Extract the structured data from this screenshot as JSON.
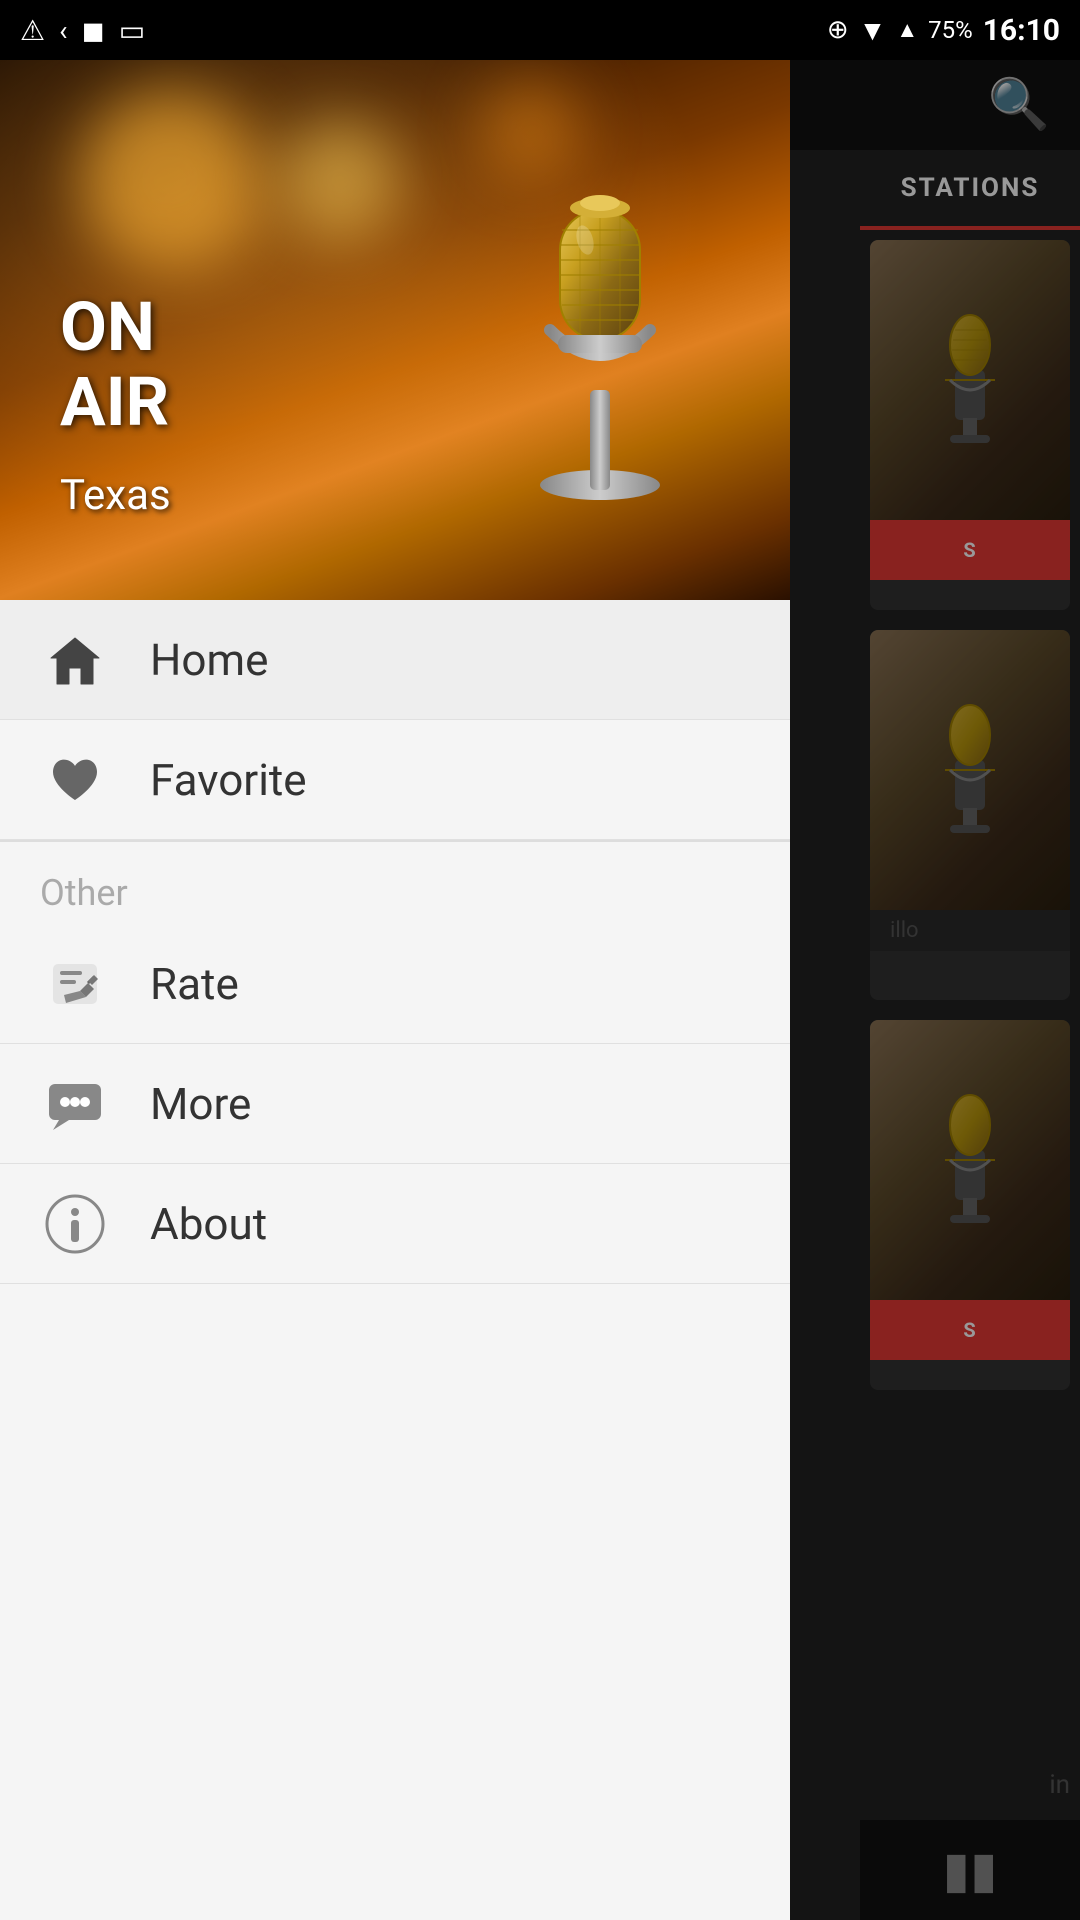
{
  "statusBar": {
    "time": "16:10",
    "battery": "75%"
  },
  "background": {
    "searchIconLabel": "search-icon",
    "stationsTab": "STATIONS",
    "playerPauseLabel": "pause"
  },
  "drawer": {
    "heroImage": {
      "onAirLine1": "ON",
      "onAirLine2": "AIR",
      "cityName": "Texas"
    },
    "menuItems": [
      {
        "id": "home",
        "label": "Home",
        "icon": "home-icon",
        "active": true
      },
      {
        "id": "favorite",
        "label": "Favorite",
        "icon": "heart-icon",
        "active": false
      }
    ],
    "sectionLabel": "Other",
    "otherItems": [
      {
        "id": "rate",
        "label": "Rate",
        "icon": "rate-icon"
      },
      {
        "id": "more",
        "label": "More",
        "icon": "more-icon"
      },
      {
        "id": "about",
        "label": "About",
        "icon": "about-icon"
      }
    ]
  }
}
